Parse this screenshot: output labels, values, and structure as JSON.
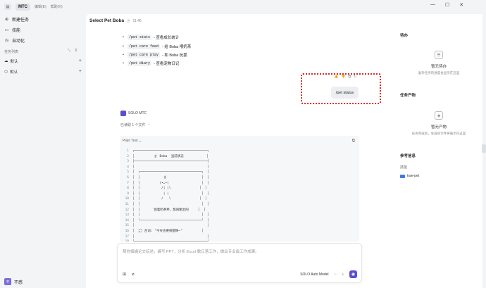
{
  "app": {
    "tag": "MTC",
    "menus": [
      "编辑(E)",
      "帮助(H)"
    ]
  },
  "sidebar": {
    "items": [
      {
        "label": "新建任务",
        "icon": "new-task-icon"
      },
      {
        "label": "技能",
        "icon": "skills-icon"
      },
      {
        "label": "自动化",
        "icon": "automation-icon"
      }
    ],
    "section_label": "任务列表",
    "groups": [
      {
        "label": "默认",
        "icon": "cloud-icon"
      },
      {
        "label": "默认",
        "icon": "folder-icon"
      }
    ],
    "user": {
      "avatar_text": "不",
      "name": "不感"
    }
  },
  "header": {
    "title": "Select Pet Boba",
    "time": "11:46"
  },
  "chat": {
    "bullets": [
      {
        "cmd": "/pet stats",
        "desc": "- 查看成长统计"
      },
      {
        "cmd": "/pet care feed",
        "desc": "- 给 Boba 喂奶茶"
      },
      {
        "cmd": "/pet care play",
        "desc": "- 和 Boba 玩耍"
      },
      {
        "cmd": "/pet diary",
        "desc": "- 查看宠物日记"
      }
    ],
    "user_message": "/pet status",
    "agent_name": "SOLO MTC",
    "read_files": "已读取 1 个文件",
    "code": {
      "lang": "Plain Text",
      "lines": [
        {
          "n": "1",
          "t": "┌──────────────────────────────────────┐"
        },
        {
          "n": "2",
          "t": "│          🧋 Boba  当前状态            │"
        },
        {
          "n": "3",
          "t": "├──────────────────────────────────────┤"
        },
        {
          "n": "4",
          "t": "│                                      │"
        },
        {
          "n": "5",
          "t": "│  ┌────────────────────────────────┐  │"
        },
        {
          "n": "6",
          "t": "│  │            🧋                  │  │"
        },
        {
          "n": "7",
          "t": "│  │          (•ᴗ•)                 │  │"
        },
        {
          "n": "8",
          "t": "│  │           /| |\\               │  │"
        },
        {
          "n": "9",
          "t": "│  │            | |                 │  │"
        },
        {
          "n": "10",
          "t": "│  │           /   \\               │  │"
        },
        {
          "n": "11",
          "t": "│  │                                │  │"
        },
        {
          "n": "12",
          "t": "│  │       饱着奶茶杯，悠闲晒太阳     │  │"
        },
        {
          "n": "13",
          "t": "│  │                                │  │"
        },
        {
          "n": "14",
          "t": "│  └────────────────────────────────┘  │"
        },
        {
          "n": "15",
          "t": "│                                      │"
        },
        {
          "n": "16",
          "t": "│  💭 台词: \"今天也要很甜呀~\"          │"
        },
        {
          "n": "17",
          "t": "│                                      │"
        },
        {
          "n": "18",
          "t": "└──────────────────────────────────────┘"
        }
      ]
    }
  },
  "composer": {
    "placeholder": "帮你撰编论文综述，编写 PPT，分析 Excel 数日落工作，做出专业级工作成果。",
    "model": "SOLO Auto Model"
  },
  "right_panel": {
    "todo_title": "待办",
    "todo_empty": "暂无待办",
    "todo_hint": "复杂任务的进度会显示在这里",
    "artifacts_title": "任务产物",
    "artifacts_empty": "暂无产物",
    "artifacts_hint": "任务完成后，生成的文件将展示在这里",
    "ref_title": "参考信息",
    "ref_label": "技能",
    "ref_item": "trae-pet"
  }
}
